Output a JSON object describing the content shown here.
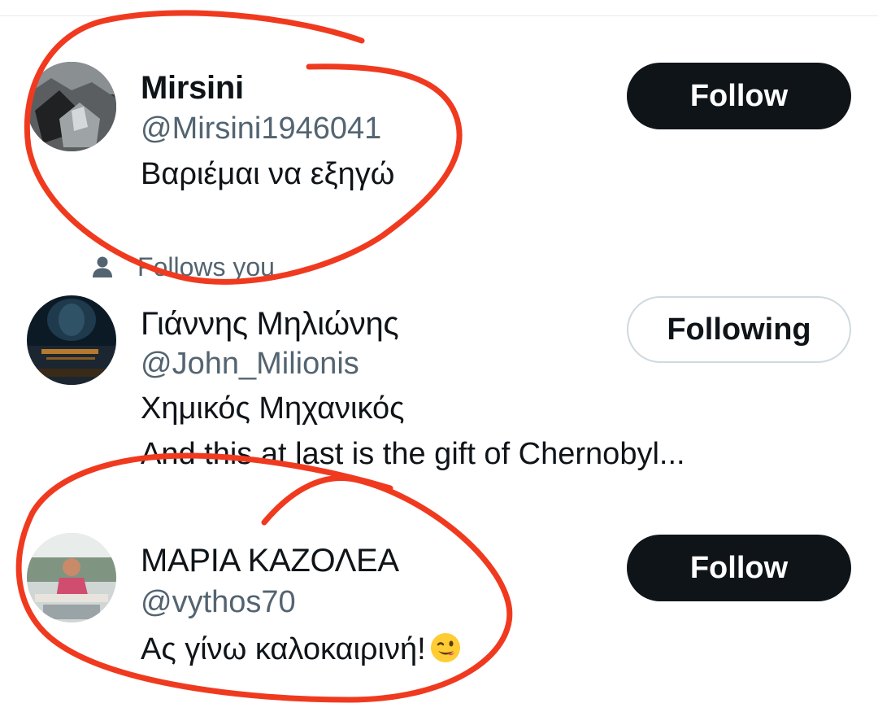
{
  "users": [
    {
      "display_name": "Mirsini",
      "handle": "@Mirsini1946041",
      "bio_lines": [
        "Βαριέμαι να εξηγώ"
      ],
      "button_label": "Follow",
      "avatar_icon": "avatar-photo-dark-rock"
    },
    {
      "follows_you_label": "Follows you",
      "follows_you_icon": "person-icon",
      "display_name": "Γιάννης Μηλιώνης",
      "handle": "@John_Milionis",
      "bio_lines": [
        "Χημικός Μηχανικός",
        "And this at last is the gift of Chernobyl..."
      ],
      "button_label": "Following",
      "avatar_icon": "avatar-photo-night-statue"
    },
    {
      "display_name": "ΜΑΡΙΑ ΚΑΖΟΛΕΑ",
      "handle": "@vythos70",
      "bio_lines": [
        "Ας γίνω καλοκαιρινή!"
      ],
      "bio_emoji": "winking-face-emoji",
      "button_label": "Follow",
      "avatar_icon": "avatar-photo-woman-outdoor"
    }
  ],
  "colors": {
    "primary_text": "#0f1419",
    "secondary_text": "#536471",
    "follow_button_bg": "#0f1419",
    "following_button_border": "#cfd9de",
    "annotation_stroke": "#f03a1f"
  }
}
